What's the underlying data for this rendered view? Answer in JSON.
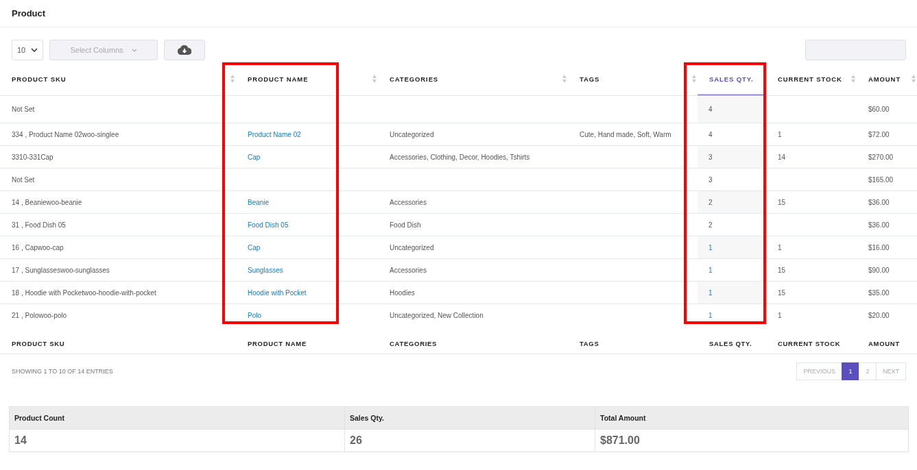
{
  "page_title": "Product",
  "toolbar": {
    "page_size": "10",
    "columns_select": {
      "placeholder": "Select Columns"
    }
  },
  "columns": [
    {
      "label": "PRODUCT SKU",
      "sorted": false,
      "highlighted": false
    },
    {
      "label": "PRODUCT NAME",
      "sorted": false,
      "highlighted": true
    },
    {
      "label": "CATEGORIES",
      "sorted": false,
      "highlighted": false
    },
    {
      "label": "TAGS",
      "sorted": false,
      "highlighted": false
    },
    {
      "label": "SALES QTY.",
      "sorted": true,
      "highlighted": true
    },
    {
      "label": "CURRENT STOCK",
      "sorted": false,
      "highlighted": false
    },
    {
      "label": "AMOUNT",
      "sorted": false,
      "highlighted": false
    }
  ],
  "rows": [
    {
      "sku": "Not Set",
      "sales_qty": "4",
      "qty_link": false,
      "amount": "$60.00"
    },
    {
      "sku": "334 , Product Name 02woo-singlee",
      "name": "Product Name 02",
      "categories": "Uncategorized",
      "tags": "Cute, Hand made, Soft, Warm",
      "sales_qty": "4",
      "qty_link": false,
      "current_stock": "1",
      "amount": "$72.00"
    },
    {
      "sku": "3310-331Cap",
      "name": "Cap",
      "categories": "Accessories, Clothing, Decor, Hoodies, Tshirts",
      "sales_qty": "3",
      "qty_link": false,
      "current_stock": "14",
      "amount": "$270.00"
    },
    {
      "sku": "Not Set",
      "sales_qty": "3",
      "qty_link": false,
      "amount": "$165.00"
    },
    {
      "sku": "14 , Beaniewoo-beanie",
      "name": "Beanie",
      "categories": "Accessories",
      "sales_qty": "2",
      "qty_link": false,
      "current_stock": "15",
      "amount": "$36.00"
    },
    {
      "sku": "31 , Food Dish 05",
      "name": "Food Dish 05",
      "categories": "Food Dish",
      "sales_qty": "2",
      "qty_link": false,
      "amount": "$36.00"
    },
    {
      "sku": "16 , Capwoo-cap",
      "name": "Cap",
      "categories": "Uncategorized",
      "sales_qty": "1",
      "qty_link": true,
      "current_stock": "1",
      "amount": "$16.00"
    },
    {
      "sku": "17 , Sunglasseswoo-sunglasses",
      "name": "Sunglasses",
      "categories": "Accessories",
      "sales_qty": "1",
      "qty_link": true,
      "current_stock": "15",
      "amount": "$90.00"
    },
    {
      "sku": "18 , Hoodie with Pocketwoo-hoodie-with-pocket",
      "name": "Hoodie with Pocket",
      "categories": "Hoodies",
      "sales_qty": "1",
      "qty_link": true,
      "current_stock": "15",
      "amount": "$35.00"
    },
    {
      "sku": "21 , Polowoo-polo",
      "name": "Polo",
      "categories": "Uncategorized, New Collection",
      "sales_qty": "1",
      "qty_link": true,
      "current_stock": "1",
      "amount": "$20.00"
    }
  ],
  "footer_columns": [
    "PRODUCT SKU",
    "PRODUCT NAME",
    "CATEGORIES",
    "TAGS",
    "SALES QTY.",
    "CURRENT STOCK",
    "AMOUNT"
  ],
  "info": "SHOWING 1 TO 10 OF 14 ENTRIES",
  "pagination": [
    {
      "label": "PREVIOUS",
      "selected": false
    },
    {
      "label": "1",
      "selected": true
    },
    {
      "label": "2",
      "selected": false
    },
    {
      "label": "NEXT",
      "selected": false
    }
  ],
  "summary": [
    {
      "label": "Product Count",
      "value": "14"
    },
    {
      "label": "Sales Qty.",
      "value": "26"
    },
    {
      "label": "Total Amount",
      "value": "$871.00"
    }
  ]
}
